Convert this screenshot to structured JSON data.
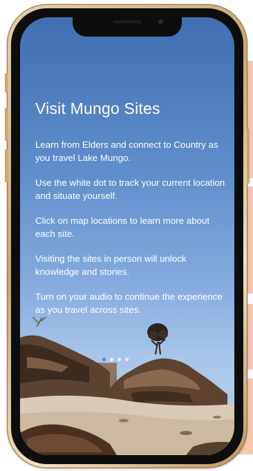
{
  "onboarding": {
    "title": "Visit Mungo Sites",
    "paragraphs": [
      "Learn from Elders and connect to Country as you travel Lake Mungo.",
      "Use the white dot to track your current location and situate yourself.",
      "Click on map locations to learn more about each site.",
      "Visiting the sites in person will unlock knowledge and stories.",
      "Turn on your audio to continue the experience as you travel across sites."
    ],
    "pagination": {
      "total_pages": 4,
      "current_page": 1
    }
  },
  "colors": {
    "accent_dot": "#3a8ee8",
    "sky_top": "#3f6fb2",
    "frame_gold": "#c9a670",
    "background_stripe": "#f6c6ad"
  }
}
